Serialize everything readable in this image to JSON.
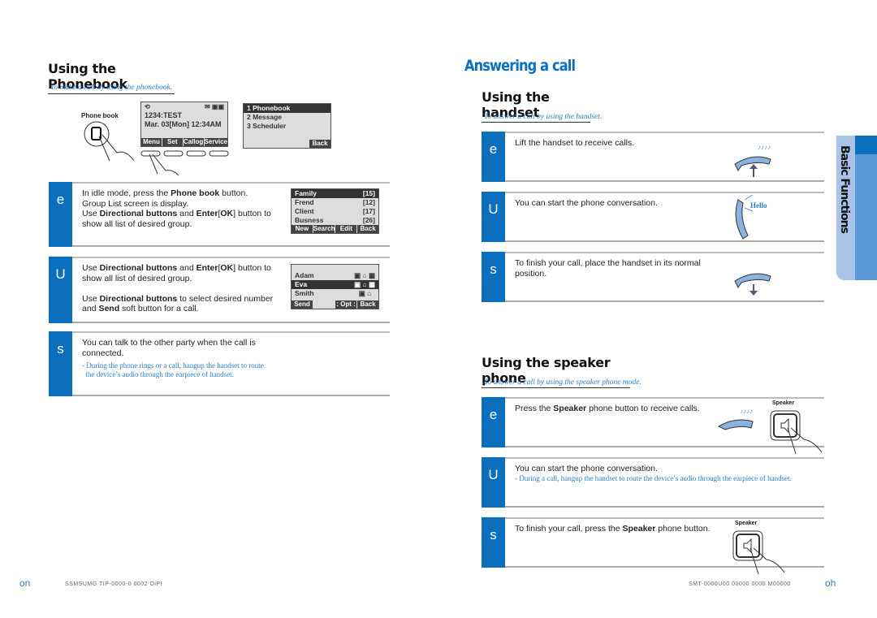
{
  "left": {
    "title": "Using the Phonebook",
    "subtitle": "To make a call by using the phonebook.",
    "phonebook_label": "Phone book",
    "idle_screen": {
      "line1": "1234:TEST",
      "line2": "Mar. 03[Mon] 12:34AM",
      "softkeys": [
        "Menu",
        "Set",
        "Callog",
        "Service"
      ]
    },
    "menu_screen": {
      "items": [
        "1 Phonebook",
        "2 Message",
        "3 Scheduler"
      ],
      "softkey": "Back"
    },
    "group_screen": {
      "rows": [
        {
          "name": "Family",
          "count": "[15]"
        },
        {
          "name": "Frend",
          "count": "[12]"
        },
        {
          "name": "Client",
          "count": "[17]"
        },
        {
          "name": "Busness",
          "count": "[26]"
        }
      ],
      "softkeys": [
        "New",
        "Search",
        "Edit",
        "Back"
      ]
    },
    "contact_screen": {
      "rows": [
        "Adam",
        "Eva",
        "Smith"
      ],
      "softkeys": [
        "Send",
        ": Opt :",
        "Back"
      ]
    },
    "steps": [
      {
        "label": "e",
        "lines": [
          [
            {
              "t": "In idle mode, press the "
            },
            {
              "t": "Phone book",
              "b": 1
            },
            {
              "t": " button."
            }
          ],
          [
            {
              "t": "Group List screen is display."
            }
          ],
          [
            {
              "t": "Use "
            },
            {
              "t": "Directional buttons",
              "b": 1
            },
            {
              "t": " and "
            },
            {
              "t": "Enter",
              "b": 1
            },
            {
              "t": "["
            },
            {
              "t": "OK",
              "b": 1
            },
            {
              "t": "] button to"
            }
          ],
          [
            {
              "t": "show all list of desired group."
            }
          ]
        ]
      },
      {
        "label": "U",
        "lines": [
          [
            {
              "t": "Use "
            },
            {
              "t": "Directional buttons",
              "b": 1
            },
            {
              "t": " and "
            },
            {
              "t": "Enter",
              "b": 1
            },
            {
              "t": "["
            },
            {
              "t": "OK",
              "b": 1
            },
            {
              "t": "] button to"
            }
          ],
          [
            {
              "t": "show all list of desired group."
            }
          ],
          [
            {
              "t": " "
            }
          ],
          [
            {
              "t": "Use "
            },
            {
              "t": "Directional buttons",
              "b": 1
            },
            {
              "t": " to select desired number"
            }
          ],
          [
            {
              "t": "and "
            },
            {
              "t": "Send",
              "b": 1
            },
            {
              "t": " soft button for a call."
            }
          ]
        ]
      },
      {
        "label": "s",
        "lines": [
          [
            {
              "t": "You can talk to the other party when the call is"
            }
          ],
          [
            {
              "t": "connected."
            }
          ]
        ],
        "note": [
          "- During the phone rings or a call, hangup the handset to route",
          "  the device’s audio through the earpiece of handset."
        ]
      }
    ]
  },
  "right": {
    "title": "Answering a call",
    "handset": {
      "title": "Using the handset",
      "subtitle": "To answer a call by using the handset.",
      "hello": "Hello",
      "steps": [
        {
          "label": "e",
          "lines": [
            [
              {
                "t": "Lift the handset to receive calls."
              }
            ]
          ]
        },
        {
          "label": "U",
          "lines": [
            [
              {
                "t": "You can start the phone conversation."
              }
            ]
          ]
        },
        {
          "label": "s",
          "lines": [
            [
              {
                "t": "To finish your call, place the handset in its normal"
              }
            ],
            [
              {
                "t": "position."
              }
            ]
          ]
        }
      ]
    },
    "speaker": {
      "title": "Using the speaker phone",
      "subtitle": "To answer a call by using the speaker phone mode.",
      "button_label": "Speaker",
      "steps": [
        {
          "label": "e",
          "lines": [
            [
              {
                "t": "Press the "
              },
              {
                "t": "Speaker",
                "b": 1
              },
              {
                "t": " phone button to receive calls."
              }
            ]
          ]
        },
        {
          "label": "U",
          "lines": [
            [
              {
                "t": "You can start the phone conversation."
              }
            ]
          ],
          "note": [
            "- During a call, hangup the handset to route the device’s audio through the earpiece of handset."
          ]
        },
        {
          "label": "s",
          "lines": [
            [
              {
                "t": "To finish your call, press the "
              },
              {
                "t": "Speaker",
                "b": 1
              },
              {
                "t": " phone button."
              }
            ]
          ]
        }
      ]
    },
    "side_tab": "Basic Functions"
  },
  "footer": {
    "left_page": "on",
    "left_text": "SSMSUMG TIP-0000-0 0002 OiPI",
    "right_text": "SMT-0000U00 00000 0000 M00000",
    "right_page": "oh"
  },
  "colors": {
    "accent": "#0b6fbe",
    "subtitle": "#2a7fc8",
    "tab_light": "#a9c3e8",
    "tab_dark": "#5b97d4"
  }
}
